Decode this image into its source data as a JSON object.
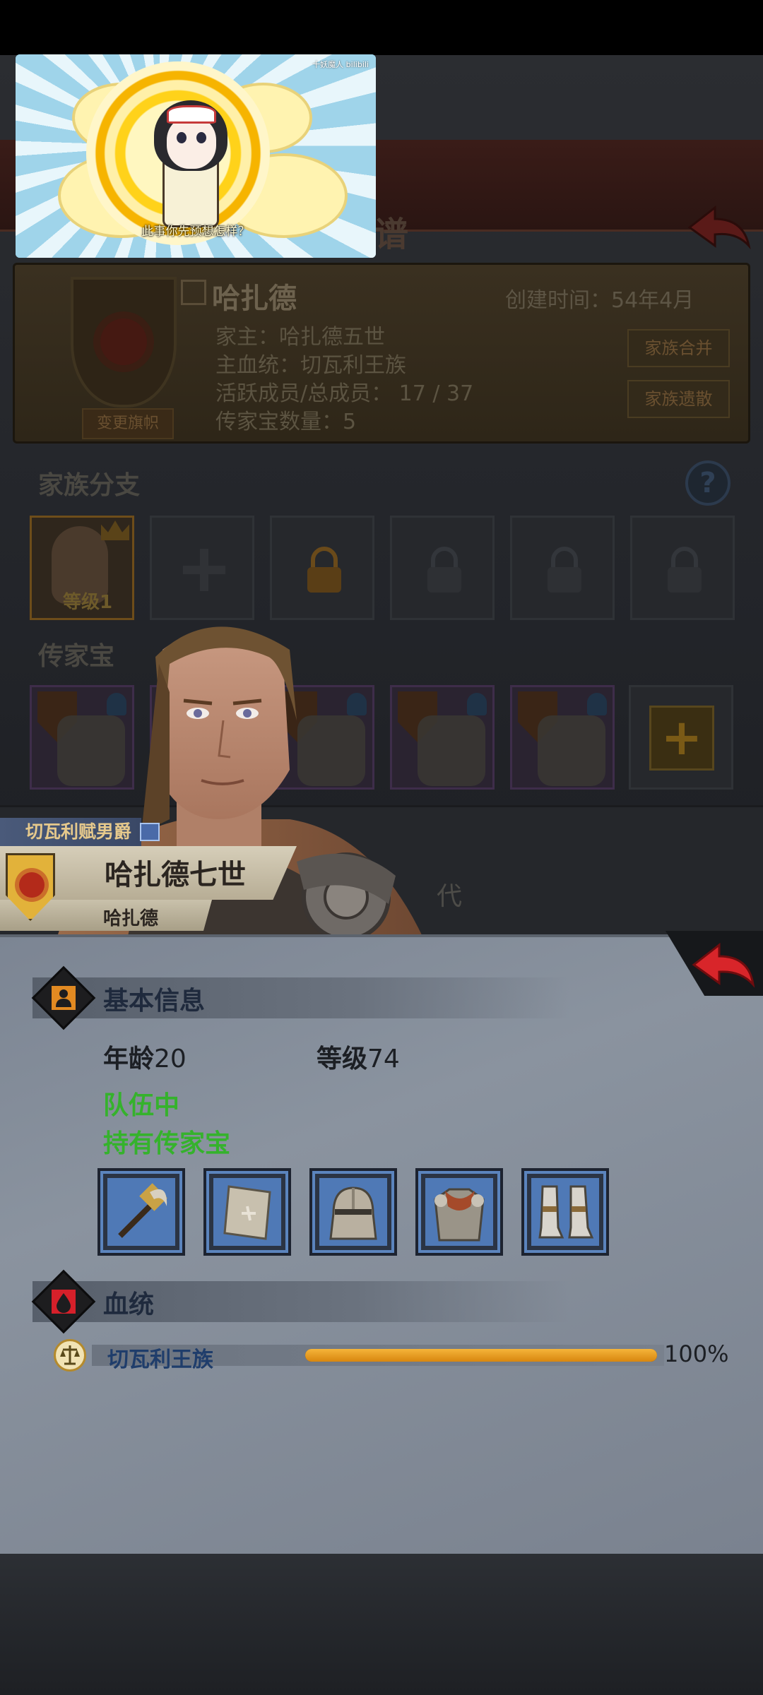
{
  "background_screen": {
    "title_fragment": "谱",
    "family_name": "哈扎德",
    "created_label": "创建时间：",
    "created_value": "54年4月",
    "head_line": "家主：哈扎德五世",
    "bloodline_line": "主血统：切瓦利王族",
    "members_line": "活跃成员/总成员： 17 / 37",
    "heirloom_count_line": "传家宝数量：5",
    "change_flag_button": "变更旗帜",
    "merge_button": "家族合并",
    "legacy_button": "家族遗散",
    "branches_heading": "家族分支",
    "help_icon_text": "?",
    "member_level": "等级1",
    "heirloom_heading": "传家宝",
    "add_symbol": "+",
    "generation_fragment": "代"
  },
  "video_overlay": {
    "subtitle": "此事你先预想怎样？",
    "watermark": "十妖魔人 bilibili"
  },
  "character": {
    "title": "切瓦利赋男爵",
    "name": "哈扎德七世",
    "family": "哈扎德"
  },
  "panel": {
    "basic_info_heading": "基本信息",
    "age_label": "年龄",
    "age_value": "20",
    "level_label": "等级",
    "level_value": "74",
    "status_in_team": "队伍中",
    "status_heirloom": "持有传家宝",
    "equipment": [
      {
        "icon": "war-hammer-icon"
      },
      {
        "icon": "shield-icon"
      },
      {
        "icon": "helmet-icon"
      },
      {
        "icon": "chainmail-armor-icon"
      },
      {
        "icon": "greaves-icon"
      }
    ],
    "bloodline_heading": "血统",
    "bloodline_name": "切瓦利王族",
    "bloodline_percent": 100,
    "bloodline_percent_text": "100%"
  },
  "colors": {
    "status_green": "#35b22c",
    "bloodline_blue": "#1f3d6b",
    "progress_orange": "#f5b43a",
    "back_red": "#d8252a"
  }
}
